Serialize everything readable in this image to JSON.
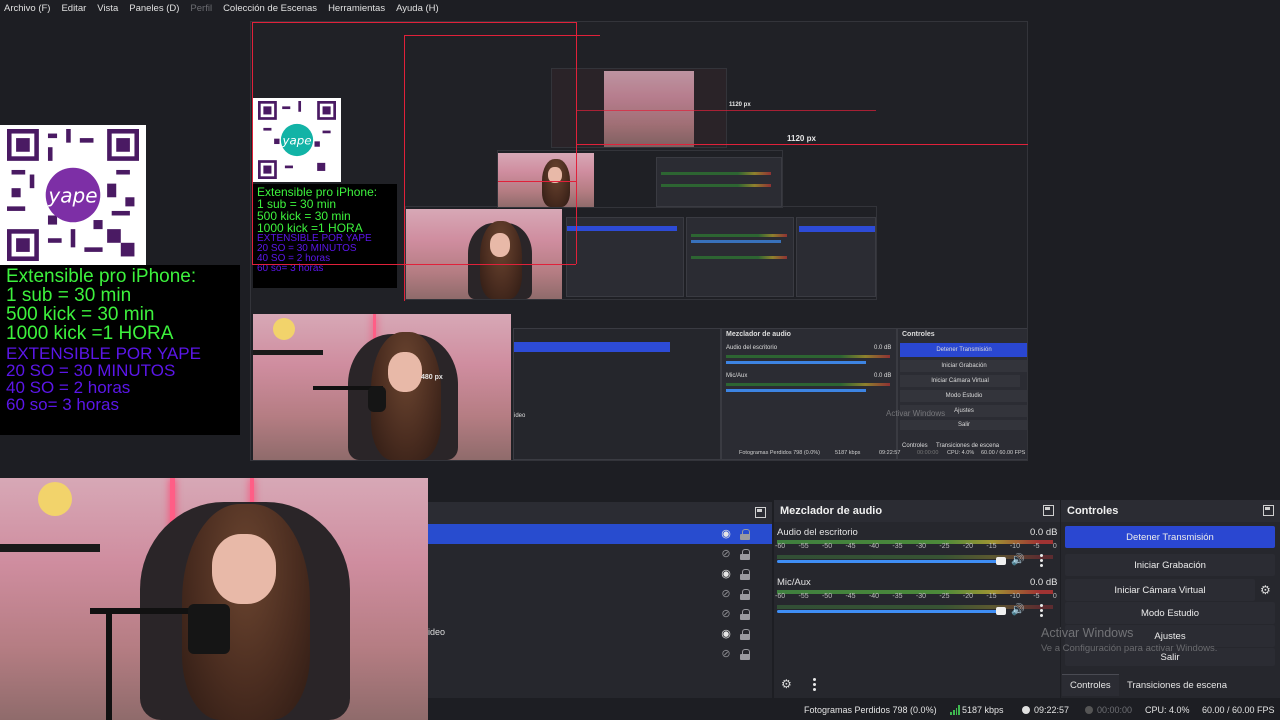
{
  "menu": {
    "items": [
      {
        "label": "Archivo (F)",
        "enabled": true
      },
      {
        "label": "Editar",
        "enabled": true
      },
      {
        "label": "Vista",
        "enabled": true
      },
      {
        "label": "Paneles (D)",
        "enabled": true
      },
      {
        "label": "Perfil",
        "enabled": false
      },
      {
        "label": "Colección de Escenas",
        "enabled": true
      },
      {
        "label": "Herramientas",
        "enabled": true
      },
      {
        "label": "Ayuda (H)",
        "enabled": true
      }
    ]
  },
  "preview": {
    "overlay": {
      "green_lines": [
        "Extensible pro iPhone:",
        "1 sub = 30 min",
        "500 kick = 30 min",
        "1000 kick =1 HORA"
      ],
      "purple_lines": [
        "EXTENSIBLE POR   YAPE",
        "20 SO = 30 MINUTOS",
        "40 SO = 2 horas",
        "60 so= 3 horas"
      ]
    },
    "qr_brand": "yape",
    "measure_labels": {
      "width_1120": "1120 px",
      "height_480": "480 px",
      "width_1120_small": "1120 px"
    },
    "mirror": {
      "mixer_title": "Mezclador de audio",
      "controls_title": "Controles",
      "desktop_audio": "Audio del escritorio",
      "mic_aux": "Mic/Aux",
      "db_1": "0.0 dB",
      "db_2": "0.0 dB",
      "video_label": "ideo",
      "buttons": [
        "Detener Transmisión",
        "Iniciar Grabación",
        "Iniciar Cámara Virtual",
        "Modo Estudio",
        "Ajustes",
        "Salir"
      ],
      "tabs": [
        "Controles",
        "Transiciones de escena"
      ],
      "watermark_1": "Activar Windows",
      "watermark_2": "Ve a Configuración para activar Windows.",
      "status": [
        "Fotogramas Perdidos 798 (0.0%)",
        "5187 kbps",
        "09:22:57",
        "00:00:00",
        "CPU: 4.0%",
        "60.00 / 60.00 FPS"
      ]
    }
  },
  "sources": {
    "rows": [
      {
        "label": "",
        "visible": true,
        "selected": true
      },
      {
        "label": "",
        "visible": false,
        "selected": false
      },
      {
        "label": "",
        "visible": true,
        "selected": false
      },
      {
        "label": "",
        "visible": false,
        "selected": false
      },
      {
        "label": "",
        "visible": false,
        "selected": false
      },
      {
        "label": "ideo",
        "visible": true,
        "selected": false
      },
      {
        "label": "",
        "visible": false,
        "selected": false
      }
    ]
  },
  "mixer": {
    "title": "Mezclador de audio",
    "channels": [
      {
        "name": "Audio del escritorio",
        "db": "0.0 dB"
      },
      {
        "name": "Mic/Aux",
        "db": "0.0 dB"
      }
    ],
    "scale": [
      "-60",
      "-55",
      "-50",
      "-45",
      "-40",
      "-35",
      "-30",
      "-25",
      "-20",
      "-15",
      "-10",
      "-5",
      "0"
    ]
  },
  "controls": {
    "title": "Controles",
    "buttons": {
      "stop_stream": "Detener Transmisión",
      "start_recording": "Iniciar Grabación",
      "virtual_cam": "Iniciar Cámara Virtual",
      "studio_mode": "Modo Estudio",
      "settings": "Ajustes",
      "exit": "Salir"
    },
    "tabs": {
      "controls": "Controles",
      "transitions": "Transiciones de escena"
    }
  },
  "watermark": {
    "line1": "Activar Windows",
    "line2": "Ve a Configuración para activar Windows."
  },
  "status": {
    "dropped_frames": "Fotogramas Perdidos 798 (0.0%)",
    "bitrate": "5187 kbps",
    "stream_time": "09:22:57",
    "rec_time": "00:00:00",
    "cpu": "CPU: 4.0%",
    "fps": "60.00 / 60.00 FPS"
  },
  "colors": {
    "accent": "#2a47d1",
    "background": "#1d1e23",
    "overlay_green": "#3df23d",
    "overlay_purple": "#5b16e8",
    "guide_red": "#e0213a"
  }
}
